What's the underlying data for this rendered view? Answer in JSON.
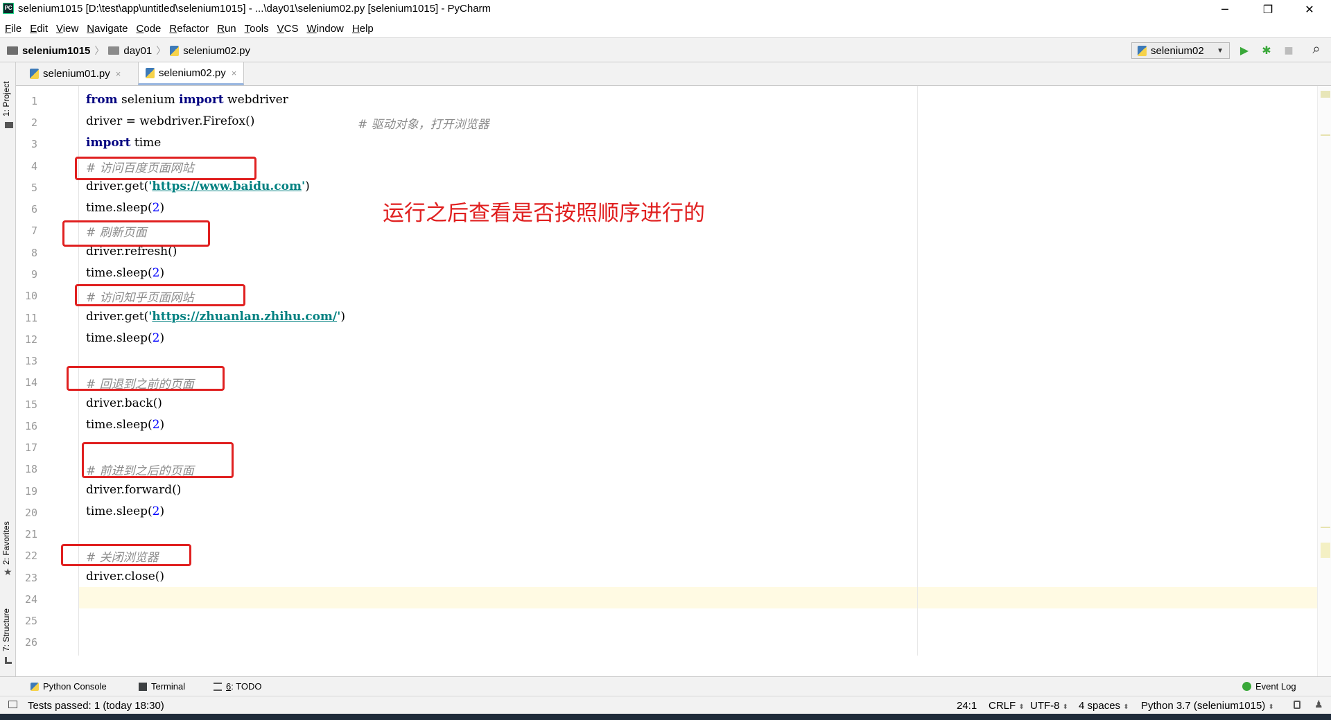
{
  "window": {
    "title": "selenium1015 [D:\\test\\app\\untitled\\selenium1015] - ...\\day01\\selenium02.py [selenium1015] - PyCharm",
    "logo_text": "PC",
    "minimize": "─",
    "restore": "❐",
    "close": "✕"
  },
  "menu": {
    "items": [
      {
        "label": "File",
        "mnemonic": "F",
        "rest": "ile"
      },
      {
        "label": "Edit",
        "mnemonic": "E",
        "rest": "dit"
      },
      {
        "label": "View",
        "mnemonic": "V",
        "rest": "iew"
      },
      {
        "label": "Navigate",
        "mnemonic": "N",
        "rest": "avigate"
      },
      {
        "label": "Code",
        "mnemonic": "C",
        "rest": "ode"
      },
      {
        "label": "Refactor",
        "mnemonic": "R",
        "rest": "efactor"
      },
      {
        "label": "Run",
        "mnemonic": "R",
        "rest": "un",
        "pre": ""
      },
      {
        "label": "Tools",
        "mnemonic": "T",
        "rest": "ools"
      },
      {
        "label": "VCS",
        "mnemonic": "V",
        "rest": "CS"
      },
      {
        "label": "Window",
        "mnemonic": "W",
        "rest": "indow"
      },
      {
        "label": "Help",
        "mnemonic": "H",
        "rest": "elp"
      }
    ]
  },
  "breadcrumb": {
    "project": "selenium1015",
    "folder": "day01",
    "file": "selenium02.py"
  },
  "toolbar": {
    "run_config": "selenium02",
    "run_icon": "▶",
    "debug_icon": "✱",
    "stop_icon": "■",
    "search_icon": "⌕"
  },
  "tool_strip": {
    "project": "1: Project",
    "favorites": "2: Favorites",
    "structure": "7: Structure"
  },
  "tabs": [
    {
      "label": "selenium01.py",
      "active": false
    },
    {
      "label": "selenium02.py",
      "active": true
    }
  ],
  "tab_close": "×",
  "editor": {
    "line_numbers": [
      "1",
      "2",
      "3",
      "4",
      "5",
      "6",
      "7",
      "8",
      "9",
      "10",
      "11",
      "12",
      "13",
      "14",
      "15",
      "16",
      "17",
      "18",
      "19",
      "20",
      "21",
      "22",
      "23",
      "24",
      "25",
      "26"
    ],
    "lines": {
      "l1": {
        "kw1": "from",
        "t1": " selenium ",
        "kw2": "import",
        "t2": " webdriver"
      },
      "l2": {
        "t1": "driver = webdriver.Firefox()",
        "c": "# 驱动对象，打开浏览器"
      },
      "l3": {
        "kw1": "import",
        "t1": " time"
      },
      "l4": {
        "c": "# 访问百度页面网站"
      },
      "l5": {
        "t1": "driver.get(",
        "q1": "'",
        "url": "https://www.baidu.com",
        "q2": "'",
        "t2": ")"
      },
      "l6": {
        "t1": "time.sleep(",
        "n": "2",
        "t2": ")"
      },
      "l7": {
        "c": "# 刷新页面"
      },
      "l8": {
        "t1": "driver.refresh()"
      },
      "l9": {
        "t1": "time.sleep(",
        "n": "2",
        "t2": ")"
      },
      "l10": {
        "c": "# 访问知乎页面网站"
      },
      "l11": {
        "t1": "driver.get(",
        "q1": "'",
        "url": "https://zhuanlan.zhihu.com/",
        "q2": "'",
        "t2": ")"
      },
      "l12": {
        "t1": "time.sleep(",
        "n": "2",
        "t2": ")"
      },
      "l14": {
        "c": "# 回退到之前的页面"
      },
      "l15": {
        "t1": "driver.back()"
      },
      "l16": {
        "t1": "time.sleep(",
        "n": "2",
        "t2": ")"
      },
      "l18": {
        "c": "# 前进到之后的页面"
      },
      "l19": {
        "t1": "driver.forward()"
      },
      "l20": {
        "t1": "time.sleep(",
        "n": "2",
        "t2": ")"
      },
      "l22": {
        "c": "# 关闭浏览器"
      },
      "l23": {
        "t1": "driver.close()"
      }
    },
    "annotation": "运行之后查看是否按照顺序进行的",
    "annotation_color": "#e02020"
  },
  "bottom_tools": {
    "python_console": "Python Console",
    "terminal": "Terminal",
    "todo_num": "6",
    "todo_rest": ": TODO",
    "event_log": "Event Log"
  },
  "status": {
    "tests": "Tests passed: 1 (today 18:30)",
    "position": "24:1",
    "line_sep": "CRLF",
    "encoding": "UTF-8",
    "indent": "4 spaces",
    "interpreter": "Python 3.7 (selenium1015)"
  }
}
